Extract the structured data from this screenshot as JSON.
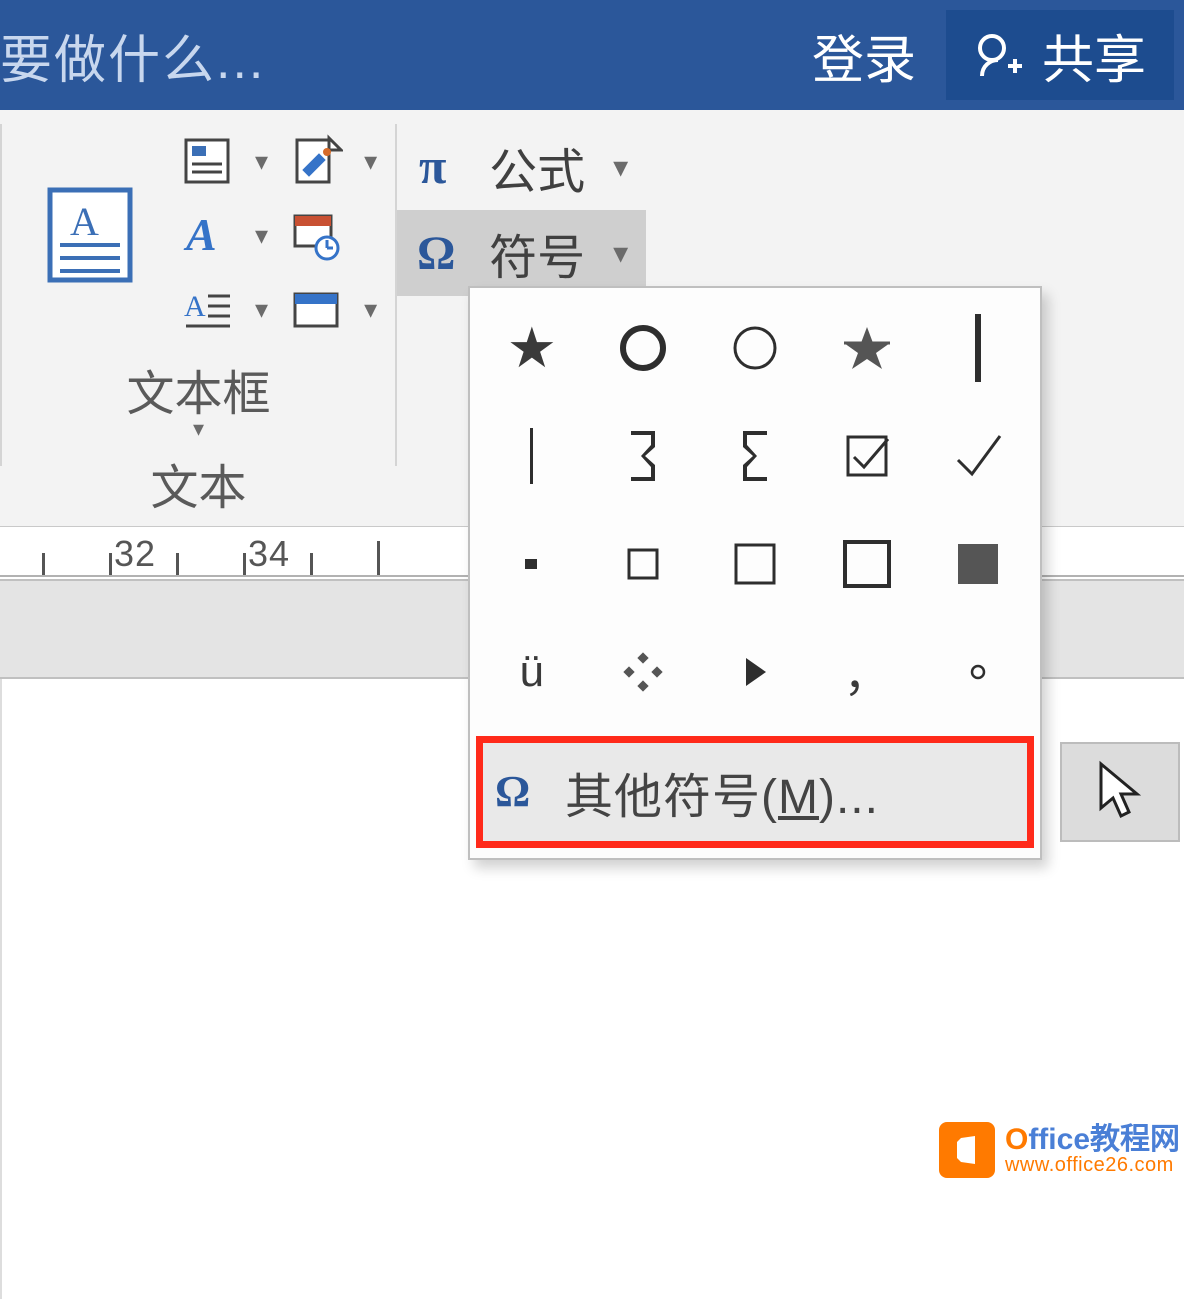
{
  "titlebar": {
    "tell_me": "要做什么...",
    "signin": "登录",
    "share": "共享"
  },
  "ribbon": {
    "textbox_label": "文本框",
    "text_group_label": "文本",
    "equation_label": "公式",
    "symbol_label": "符号"
  },
  "ruler": {
    "marks": [
      "32",
      "34"
    ]
  },
  "symbol_popup": {
    "cells": [
      "★",
      "○",
      "○",
      "★",
      "|",
      "│",
      "】",
      "【",
      "☑",
      "✓",
      "▫",
      "□",
      "□",
      "□",
      "■",
      "ü",
      "❖",
      "▶",
      "，",
      "。"
    ],
    "more_label_prefix": "其他符号(",
    "more_label_key": "M",
    "more_label_suffix": ")..."
  },
  "watermark": {
    "title_o": "O",
    "title_rest": "ffice教程网",
    "url": "www.office26.com",
    "badge_letter": "O"
  }
}
